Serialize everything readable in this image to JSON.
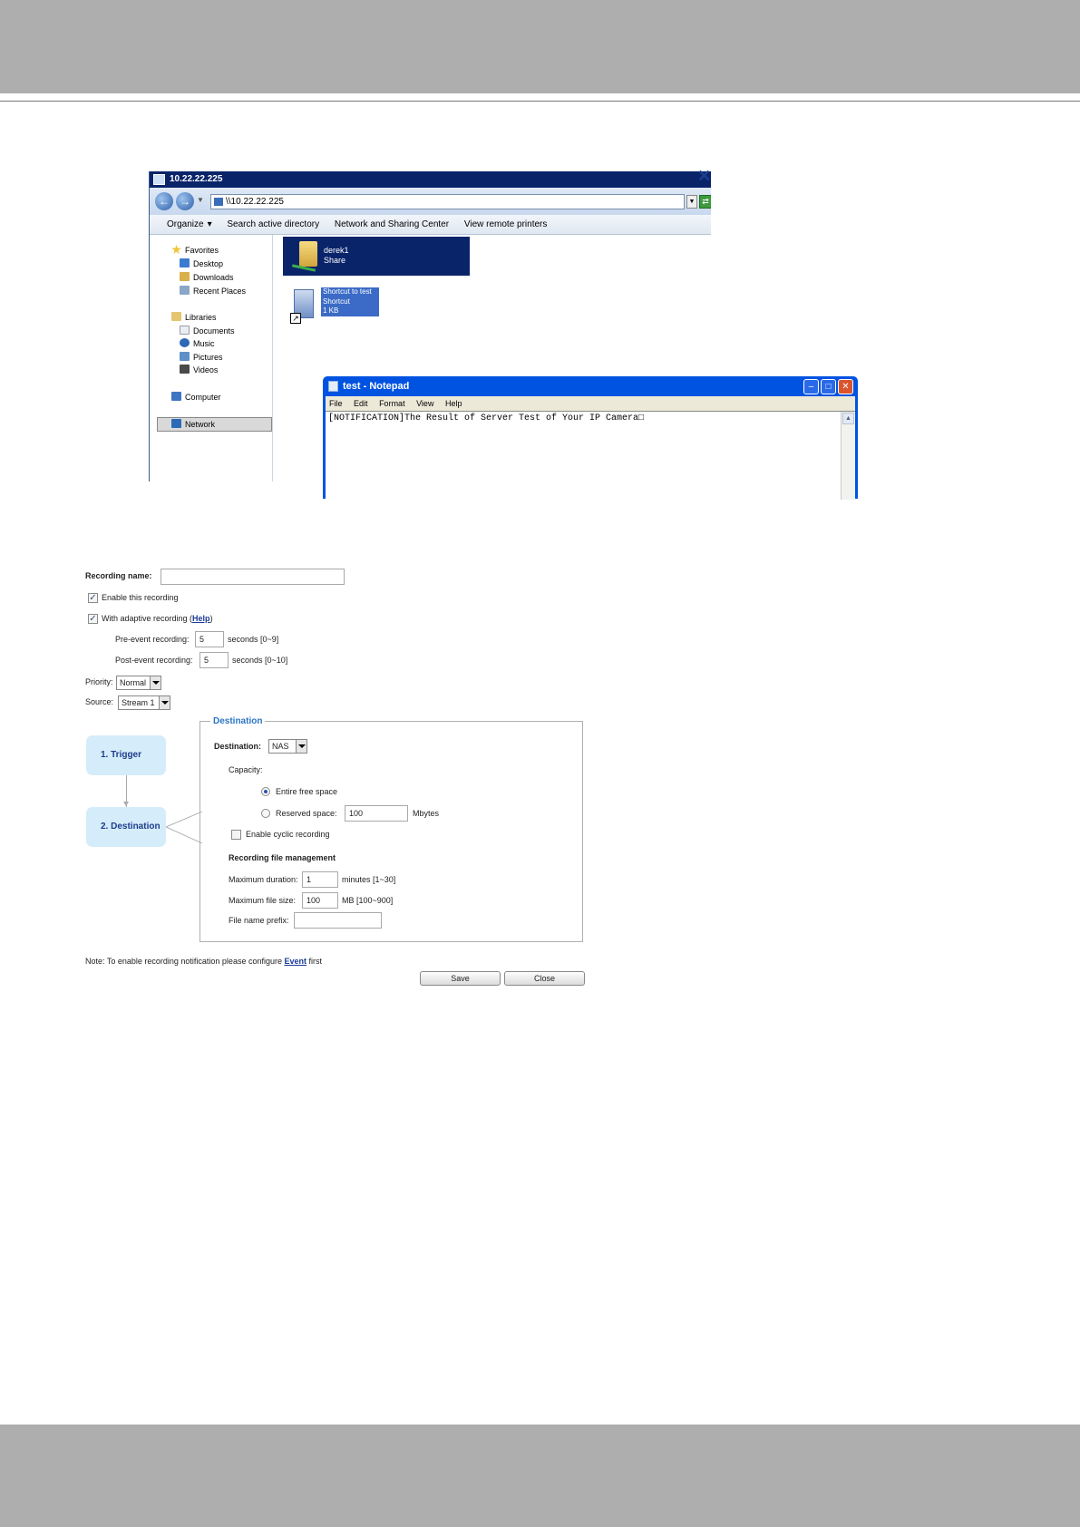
{
  "explorer": {
    "title": "10.22.22.225",
    "address": "\\\\10.22.22.225",
    "toolbar": {
      "organize": "Organize",
      "search": "Search active directory",
      "network_sharing": "Network and Sharing Center",
      "remote_printers": "View remote printers"
    },
    "nav": {
      "favorites": "Favorites",
      "desktop": "Desktop",
      "downloads": "Downloads",
      "recent": "Recent Places",
      "libraries": "Libraries",
      "documents": "Documents",
      "music": "Music",
      "pictures": "Pictures",
      "videos": "Videos",
      "computer": "Computer",
      "network": "Network"
    },
    "share": {
      "name": "derek1",
      "type": "Share"
    },
    "shortcut": {
      "line1": "Shortcut to test",
      "line2": "Shortcut",
      "line3": "1 KB"
    }
  },
  "notepad": {
    "title": "test - Notepad",
    "menu": [
      "File",
      "Edit",
      "Format",
      "View",
      "Help"
    ],
    "content": "[NOTIFICATION]The Result of Server Test of Your IP Camera□"
  },
  "recording": {
    "name_label": "Recording name:",
    "name_value": "",
    "enable_label": "Enable this recording",
    "adaptive_label": "With adaptive recording (",
    "adaptive_help": "Help",
    "adaptive_close": ")",
    "pre_label": "Pre-event recording:",
    "pre_value": "5",
    "pre_unit": "seconds [0~9]",
    "post_label": "Post-event recording:",
    "post_value": "5",
    "post_unit": "seconds [0~10]",
    "priority_label": "Priority:",
    "priority_value": "Normal",
    "source_label": "Source:",
    "source_value": "Stream 1",
    "steps": [
      "1.  Trigger",
      "2.  Destination"
    ],
    "destination_legend": "Destination",
    "destination_label": "Destination:",
    "destination_value": "NAS",
    "capacity_label": "Capacity:",
    "entire_label": "Entire free space",
    "reserved_label": "Reserved space:",
    "reserved_value": "100",
    "reserved_unit": "Mbytes",
    "cyclic_label": "Enable cyclic recording",
    "file_mgmt_label": "Recording file management",
    "max_duration_label": "Maximum duration:",
    "max_duration_value": "1",
    "max_duration_unit": "minutes [1~30]",
    "max_size_label": "Maximum file size:",
    "max_size_value": "100",
    "max_size_unit": "MB [100~900]",
    "prefix_label": "File name prefix:",
    "prefix_value": "",
    "note_text": "Note: To enable recording notification please configure ",
    "note_link": "Event",
    "note_tail": " first",
    "save_label": "Save",
    "close_label": "Close"
  }
}
